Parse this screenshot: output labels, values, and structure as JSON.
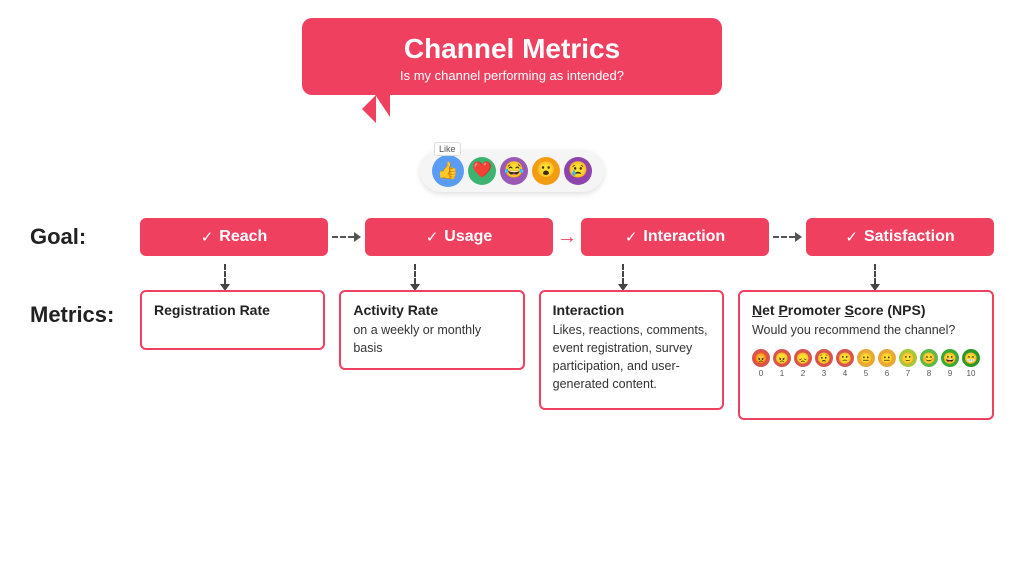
{
  "title": {
    "main": "Channel Metrics",
    "sub": "Is my channel performing as intended?"
  },
  "goal_label": "Goal:",
  "metrics_label": "Metrics:",
  "goals": [
    {
      "id": "reach",
      "label": "Reach"
    },
    {
      "id": "usage",
      "label": "Usage"
    },
    {
      "id": "interaction",
      "label": "Interaction"
    },
    {
      "id": "satisfaction",
      "label": "Satisfaction"
    }
  ],
  "metrics": [
    {
      "id": "registration-rate",
      "title": "Registration Rate",
      "body": ""
    },
    {
      "id": "activity-rate",
      "title": "Activity Rate",
      "body": "on a weekly or monthly basis"
    },
    {
      "id": "interaction",
      "title": "Interaction",
      "body": "Likes, reactions, comments, event registration, survey participation, and user-generated content."
    },
    {
      "id": "nps",
      "title": "Net Promoter Score (NPS)",
      "body": "Would you recommend the channel?",
      "nps_title_segments": [
        "N",
        "et ",
        "P",
        "romoter ",
        "S",
        "core (NPS)"
      ]
    }
  ],
  "nps_dots": [
    {
      "value": 0,
      "color": "#d9534f"
    },
    {
      "value": 1,
      "color": "#d9534f"
    },
    {
      "value": 2,
      "color": "#d9534f"
    },
    {
      "value": 3,
      "color": "#d9534f"
    },
    {
      "value": 4,
      "color": "#d9534f"
    },
    {
      "value": 5,
      "color": "#e8a838"
    },
    {
      "value": 6,
      "color": "#e8a838"
    },
    {
      "value": 7,
      "color": "#a8c83a"
    },
    {
      "value": 8,
      "color": "#5cba4a"
    },
    {
      "value": 9,
      "color": "#3aaa35"
    },
    {
      "value": 10,
      "color": "#2a9828"
    }
  ]
}
